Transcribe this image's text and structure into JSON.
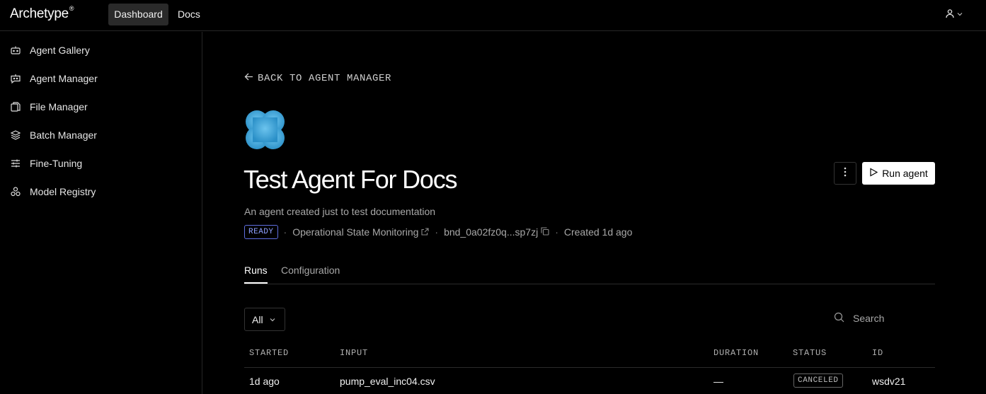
{
  "app": {
    "logo": "Archetype",
    "logo_mark": "®"
  },
  "topnav": {
    "dashboard": "Dashboard",
    "docs": "Docs"
  },
  "sidebar": {
    "items": [
      {
        "label": "Agent Gallery",
        "icon": "bot-icon"
      },
      {
        "label": "Agent Manager",
        "icon": "bot-message-icon"
      },
      {
        "label": "File Manager",
        "icon": "files-icon"
      },
      {
        "label": "Batch Manager",
        "icon": "layers-icon"
      },
      {
        "label": "Fine-Tuning",
        "icon": "sliders-icon"
      },
      {
        "label": "Model Registry",
        "icon": "boxes-icon"
      }
    ]
  },
  "main": {
    "back_label": "BACK TO AGENT MANAGER",
    "title": "Test Agent For Docs",
    "subtitle": "An agent created just to test documentation",
    "status": "READY",
    "lens": "Operational State Monitoring",
    "agent_id": "bnd_0a02fz0q...sp7zj",
    "created": "Created 1d ago",
    "run_button": "Run agent",
    "tabs": [
      {
        "label": "Runs",
        "active": true
      },
      {
        "label": "Configuration",
        "active": false
      }
    ],
    "filter_value": "All",
    "search_placeholder": "Search"
  },
  "table": {
    "headers": [
      "STARTED",
      "INPUT",
      "DURATION",
      "STATUS",
      "ID"
    ],
    "rows": [
      {
        "started": "1d ago",
        "input": "pump_eval_inc04.csv",
        "duration": "—",
        "status": "CANCELED",
        "id": "wsdv21"
      }
    ]
  },
  "colors": {
    "accent_badge": "#8ea0ff",
    "background": "#000000",
    "primary_button": "#ffffff"
  }
}
